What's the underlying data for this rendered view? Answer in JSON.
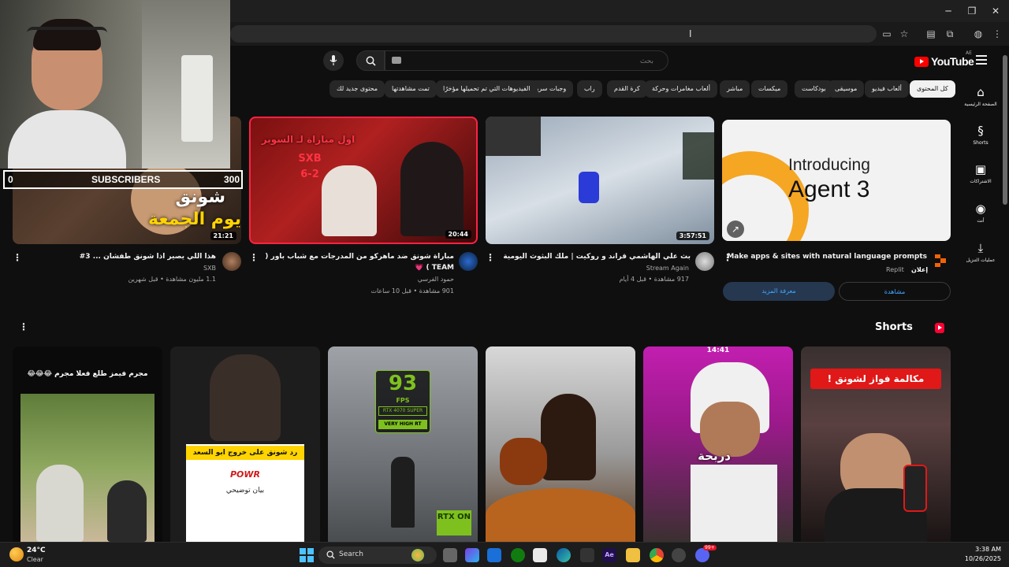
{
  "browser": {
    "window_controls": {
      "minimize": "─",
      "restore": "❐",
      "close": "✕"
    },
    "cursor": "I"
  },
  "header": {
    "logo_text": "YouTube",
    "logo_region": "AE",
    "search_placeholder": "بحث",
    "icons": [
      "mic-icon",
      "search-icon",
      "menu-icon"
    ]
  },
  "chips": [
    {
      "label": "كل المحتوى",
      "active": true
    },
    {
      "label": "ألعاب فيديو"
    },
    {
      "label": "موسيقى"
    },
    {
      "label": "بودكاست"
    },
    {
      "label": "ميكسات"
    },
    {
      "label": "مباشر"
    },
    {
      "label": "ألعاب مغامرات وحركة"
    },
    {
      "label": "كرة القدم"
    },
    {
      "label": "راب"
    },
    {
      "label": "وجبات سريعة"
    },
    {
      "label": "الفيديوهات التي تم تحميلها مؤخرًا"
    },
    {
      "label": "تمت مشاهدتها"
    },
    {
      "label": "محتوى جديد لك"
    }
  ],
  "sidebar": [
    {
      "label": "الصفحة الرئيسية",
      "icon": "home-icon",
      "glyph": "⌂"
    },
    {
      "label": "Shorts",
      "icon": "shorts-icon",
      "glyph": "§"
    },
    {
      "label": "الاشتراكات",
      "icon": "subscriptions-icon",
      "glyph": "▣"
    },
    {
      "label": "أنت",
      "icon": "you-icon",
      "glyph": "◉"
    },
    {
      "label": "عمليات التنزيل",
      "icon": "download-icon",
      "glyph": "⤓"
    }
  ],
  "videos": [
    {
      "title": "هذا اللي يصير اذا شونق طفشان ... 3#",
      "channel": "SXB",
      "meta": "1.1 مليون مشاهدة • قبل شهرين",
      "duration": "21:21",
      "thumb_text": "يوم الجمعة",
      "thumb_text2": "شونق"
    },
    {
      "title": "مباراة شونق ضد ماهركو من المدرجات مع شباب باور ( SXB",
      "title2": "TEAM ) 💗",
      "channel": "حمود الفرسي",
      "meta": "901 مشاهدة • قبل 10 ساعات",
      "duration": "20:44",
      "thumb_text": "اول مباراة لـ السوبر",
      "thumb_score": "SXB",
      "thumb_score2": "6-2"
    },
    {
      "title": "بث علي الهاشمي قراند و روكيت | ملك البثوث اليومية",
      "channel": "Stream Again",
      "meta": "917 مشاهدة • قبل 4 أيام",
      "duration": "3:57:51"
    }
  ],
  "ad": {
    "headline_line1": "Introducing",
    "headline_line2": "Agent 3",
    "title": "Make apps & sites with natural language prompts",
    "sponsor": "إعلان",
    "advertiser": "Replit",
    "primary_button": "مشاهدة",
    "secondary_button": "معرفة المزيد"
  },
  "shorts": {
    "title": "Shorts",
    "items": [
      {
        "caption": "مجرم فيمز طلع فعلا مجرم 😂😂😂"
      },
      {
        "caption": "رد شونق على خروج ابو السعد",
        "sub": "بيان توضيحي",
        "brand": "POWR"
      },
      {
        "fps": "93",
        "fps_label": "FPS",
        "gpu": "RTX 4070 SUPER",
        "preset": "VERY HIGH RT",
        "rtx": "RTX ON"
      },
      {
        "caption": ""
      },
      {
        "time": "14:41",
        "caption": "دربحة"
      },
      {
        "caption": "مكالمة فواز لشونق !"
      }
    ]
  },
  "webcam": {
    "sub_left": "0",
    "sub_label": "SUBSCRIBERS",
    "sub_right": "300"
  },
  "taskbar": {
    "weather_temp": "24°C",
    "weather_desc": "Clear",
    "search_label": "Search",
    "time": "3:38 AM",
    "date": "10/26/2025",
    "notif_badge": "99+"
  }
}
